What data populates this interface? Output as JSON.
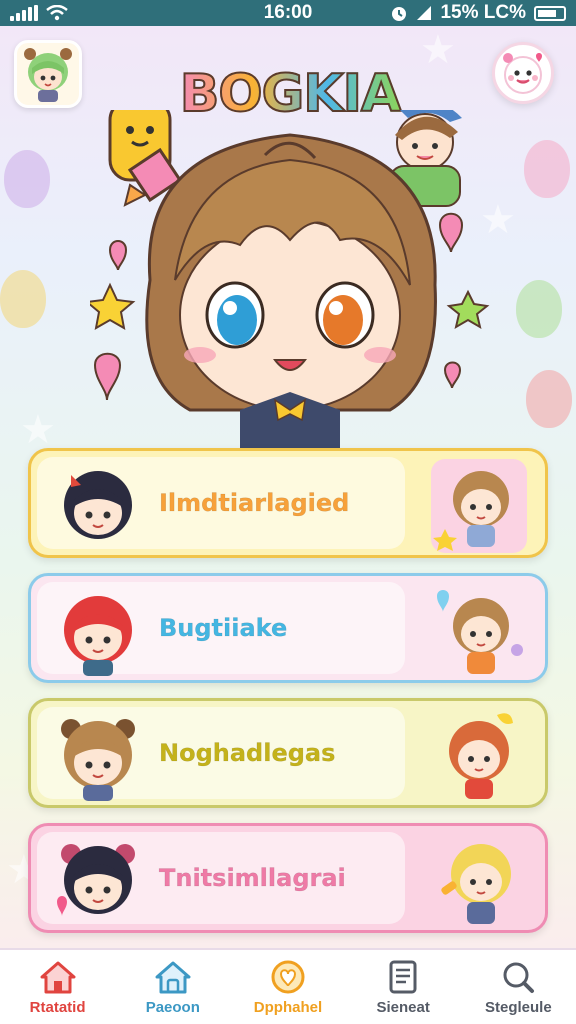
{
  "status_bar": {
    "time": "16:00",
    "battery_text": "15% LC%"
  },
  "app": {
    "logo_text": "BOGKIA"
  },
  "cards": [
    {
      "label": "Ilmdtiarlagied",
      "color": "#f7a13a",
      "bg": "#fdf3b8",
      "border": "#f0c44a"
    },
    {
      "label": "Bugtiiake",
      "color": "#44b6e2",
      "bg": "#fbe6f0",
      "border": "#8ccbea"
    },
    {
      "label": "Noghadlegas",
      "color": "#c4b21a",
      "bg": "#f7f5c6",
      "border": "#c9c96a"
    },
    {
      "label": "Tnitsimllagrai",
      "color": "#ef7aa6",
      "bg": "#fbd3e3",
      "border": "#ef8cb3"
    }
  ],
  "nav": [
    {
      "label": "Rtatatid",
      "icon": "home-icon",
      "color": "#e0443f"
    },
    {
      "label": "Paeoon",
      "icon": "house-icon",
      "color": "#3c98c4"
    },
    {
      "label": "Dpphahel",
      "icon": "heart-circle-icon",
      "color": "#f0a020"
    },
    {
      "label": "Sieneat",
      "icon": "document-icon",
      "color": "#555b66"
    },
    {
      "label": "Stegleule",
      "icon": "search-icon",
      "color": "#555b66"
    }
  ]
}
